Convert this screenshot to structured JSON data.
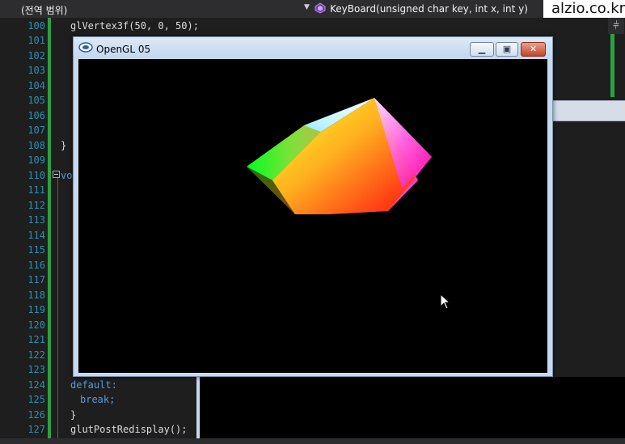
{
  "ide": {
    "scope_dropdown": "(전역 범위)",
    "member_dropdown": "KeyBoard(unsigned char key, int x, int y)",
    "watermark": "alzio.co.kr",
    "pin_glyph": "⫩"
  },
  "editor": {
    "lines": [
      {
        "num": "100",
        "code": "glVertex3f(50, 0, 50);"
      },
      {
        "num": "101",
        "code": ""
      },
      {
        "num": "102",
        "code": ""
      },
      {
        "num": "103",
        "code": ""
      },
      {
        "num": "104",
        "code": ""
      },
      {
        "num": "105",
        "code": ""
      },
      {
        "num": "106",
        "code": ""
      },
      {
        "num": "107",
        "code": ""
      },
      {
        "num": "108",
        "code": "}"
      },
      {
        "num": "109",
        "code": ""
      },
      {
        "num": "110",
        "code": "vo"
      },
      {
        "num": "111",
        "code": ""
      },
      {
        "num": "112",
        "code": ""
      },
      {
        "num": "113",
        "code": ""
      },
      {
        "num": "114",
        "code": ""
      },
      {
        "num": "115",
        "code": ""
      },
      {
        "num": "116",
        "code": ""
      },
      {
        "num": "117",
        "code": ""
      },
      {
        "num": "118",
        "code": ""
      },
      {
        "num": "119",
        "code": ""
      },
      {
        "num": "120",
        "code": ""
      },
      {
        "num": "121",
        "code": ""
      },
      {
        "num": "122",
        "code": ""
      },
      {
        "num": "123",
        "code": ""
      },
      {
        "num": "124",
        "code": "default:"
      },
      {
        "num": "125",
        "code": "break;"
      },
      {
        "num": "126",
        "code": "}"
      },
      {
        "num": "127",
        "code": "glutPostRedisplay();"
      }
    ]
  },
  "gl_window": {
    "title": "OpenGL 05",
    "minimize_glyph": "▁",
    "maximize_glyph": "▣",
    "close_glyph": "✕",
    "icon": "opengl-app-icon",
    "content": "color-cube-render"
  },
  "colors": {
    "editor_bg": "#1e1e1e",
    "line_number": "#2b91af",
    "keyword": "#569cd6",
    "change_bar": "#2ea043",
    "window_frame": "#c6d9ee",
    "close_button": "#c4442b"
  }
}
